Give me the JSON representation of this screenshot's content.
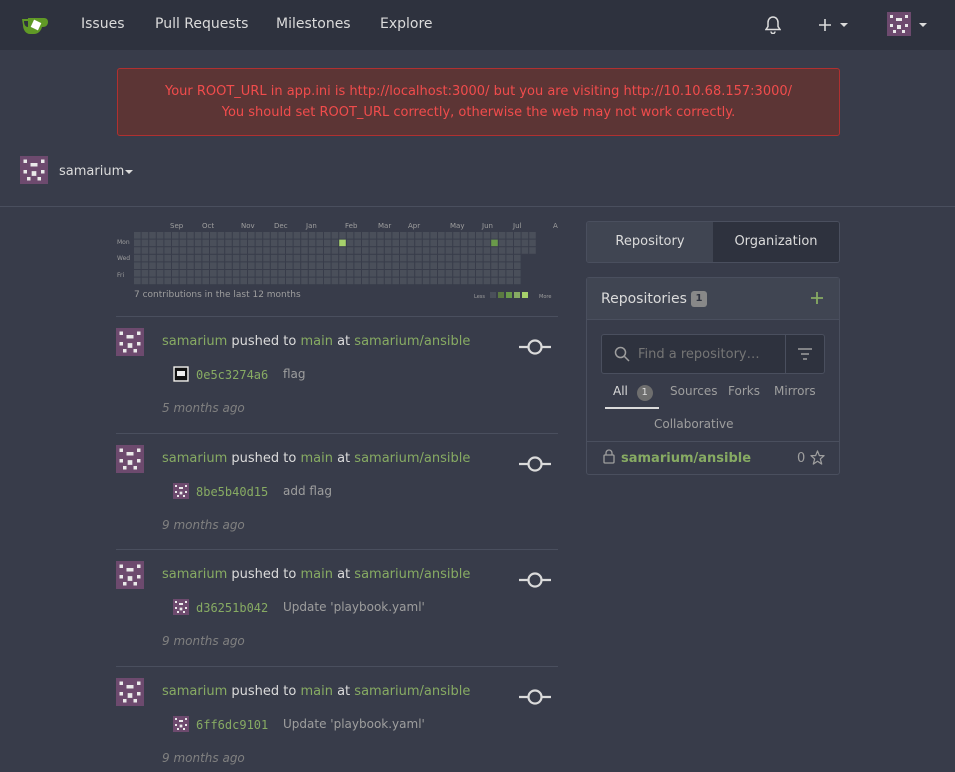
{
  "nav": {
    "items": [
      "Issues",
      "Pull Requests",
      "Milestones",
      "Explore"
    ],
    "icons": [
      "gitea-logo",
      "bell-icon",
      "plus-icon",
      "avatar"
    ]
  },
  "flash": {
    "line1": "Your ROOT_URL in app.ini is http://localhost:3000/ but you are visiting http://10.10.68.157:3000/",
    "line2": "You should set ROOT_URL correctly, otherwise the web may not work correctly."
  },
  "context": {
    "user": "samarium"
  },
  "heatmap": {
    "months": [
      "Sep",
      "Oct",
      "Nov",
      "Dec",
      "Jan",
      "Feb",
      "Mar",
      "Apr",
      "May",
      "Jun",
      "Jul",
      "Aug"
    ],
    "days": [
      "Mon",
      "Wed",
      "Fri"
    ],
    "summary": "7 contributions in the last 12 months",
    "less": "Less",
    "more": "More"
  },
  "feed": [
    {
      "user": "samarium",
      "action": "pushed to",
      "branch": "main",
      "at": "at",
      "repo": "samarium/ansible",
      "sha": "0e5c3274a6",
      "message": "flag",
      "time": "5 months ago"
    },
    {
      "user": "samarium",
      "action": "pushed to",
      "branch": "main",
      "at": "at",
      "repo": "samarium/ansible",
      "sha": "8be5b40d15",
      "message": "add flag",
      "time": "9 months ago"
    },
    {
      "user": "samarium",
      "action": "pushed to",
      "branch": "main",
      "at": "at",
      "repo": "samarium/ansible",
      "sha": "d36251b042",
      "message": "Update 'playbook.yaml'",
      "time": "9 months ago"
    },
    {
      "user": "samarium",
      "action": "pushed to",
      "branch": "main",
      "at": "at",
      "repo": "samarium/ansible",
      "sha": "6ff6dc9101",
      "message": "Update 'playbook.yaml'",
      "time": "9 months ago"
    }
  ],
  "tabs": {
    "repository": "Repository",
    "organization": "Organization"
  },
  "repos": {
    "title": "Repositories",
    "count": "1",
    "search_placeholder": "Find a repository…",
    "filters": {
      "all": "All",
      "all_count": "1",
      "sources": "Sources",
      "forks": "Forks",
      "mirrors": "Mirrors",
      "collaborative": "Collaborative"
    },
    "items": [
      {
        "name": "samarium/ansible",
        "stars": "0"
      }
    ]
  },
  "colors": {
    "accent_green": "#87ab63",
    "nav_bg": "#2e323e",
    "page_bg": "#383c4a",
    "flash_text": "#f14c4c"
  }
}
